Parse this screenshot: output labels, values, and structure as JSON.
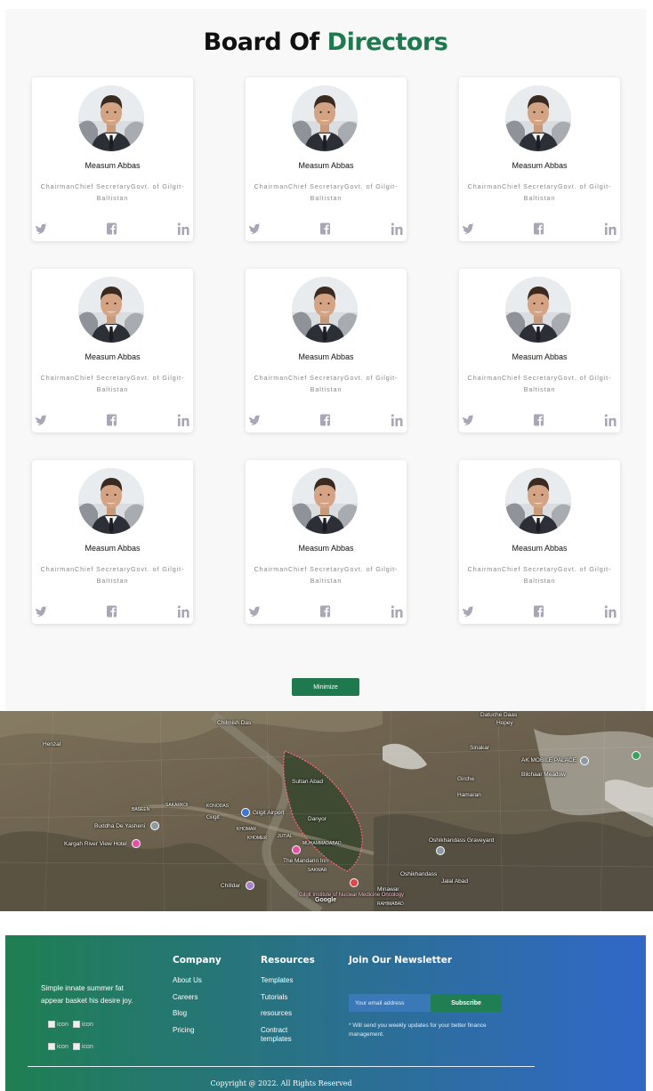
{
  "board": {
    "title_prefix": "Board Of",
    "title_accent": "Directors",
    "members": [
      {
        "name": "Measum Abbas",
        "role": "ChairmanChief SecretaryGovt. of Gilgit-Baltistan"
      },
      {
        "name": "Measum Abbas",
        "role": "ChairmanChief SecretaryGovt. of Gilgit-Baltistan"
      },
      {
        "name": "Measum Abbas",
        "role": "ChairmanChief SecretaryGovt. of Gilgit-Baltistan"
      },
      {
        "name": "Measum Abbas",
        "role": "ChairmanChief SecretaryGovt. of Gilgit-Baltistan"
      },
      {
        "name": "Measum Abbas",
        "role": "ChairmanChief SecretaryGovt. of Gilgit-Baltistan"
      },
      {
        "name": "Measum Abbas",
        "role": "ChairmanChief SecretaryGovt. of Gilgit-Baltistan"
      },
      {
        "name": "Measum Abbas",
        "role": "ChairmanChief SecretaryGovt. of Gilgit-Baltistan"
      },
      {
        "name": "Measum Abbas",
        "role": "ChairmanChief SecretaryGovt. of Gilgit-Baltistan"
      },
      {
        "name": "Measum Abbas",
        "role": "ChairmanChief SecretaryGovt. of Gilgit-Baltistan"
      }
    ],
    "social_icons": [
      "twitter-icon",
      "facebook-icon",
      "linkedin-icon"
    ],
    "minimize_label": "Minimize"
  },
  "map": {
    "labels": {
      "chilmish_das": "Chilmish Das",
      "datuche_daas": "Datuche Daas",
      "hopey": "Hopey",
      "henzal": "Henzal",
      "sinakar": "Sinakar",
      "ak_mobile_palace": "AK MOBILE PALACE",
      "bilchaar_meadow": "Bilchaar Meadow",
      "girche": "Girche",
      "sultan_abad": "Sultan Abad",
      "hamaran": "Hamaran",
      "basin": "BASEEN",
      "sakarkoi": "SAKARKOI",
      "konodas": "KONODAS",
      "gilgit": "Gilgit",
      "gilgit_airport": "Gilgit Airport",
      "danyor": "Danyor",
      "buddha": "Buddha De Yasheni",
      "kargah": "Kargah River View Hotel",
      "khomar": "KHOMAR",
      "khorrin": "KHOMER",
      "jutial": "JUTIAL",
      "muhammadabad": "MUHAMMADABAD",
      "oshikhandass_graveyard": "Oshikhandass Graveyard",
      "mandarin": "The Mandarin Inn",
      "sakwar": "SAKWAR",
      "oshikhandass": "Oshikhandass",
      "chilldar": "Chilldar",
      "jalal_abad": "Jalal Abad",
      "minawar": "Minawar",
      "oncology": "Gilgit Institute of Nuclear Medicine Oncology",
      "google": "Google",
      "rahimabad": "RAHIMABAD"
    }
  },
  "footer": {
    "tagline": "Simple innate summer fat appear basket his desire joy.",
    "icon_alt": "icon",
    "company": {
      "title": "Company",
      "links": [
        "About Us",
        "Careers",
        "Blog",
        "Pricing"
      ]
    },
    "resources": {
      "title": "Resources",
      "links": [
        "Templates",
        "Tutorials",
        "resources",
        "Contract templates"
      ]
    },
    "newsletter": {
      "title": "Join Our Newsletter",
      "placeholder": "Your email address",
      "button": "Subscribe",
      "note": "* Will send you weekly updates for your better finance management."
    },
    "copyright": "Copyright @ 2022. All Rights Reserved"
  },
  "colors": {
    "accent_green": "#1e7a4e",
    "footer_gradient_start": "#1f7f52",
    "footer_gradient_end": "#3168c9"
  }
}
